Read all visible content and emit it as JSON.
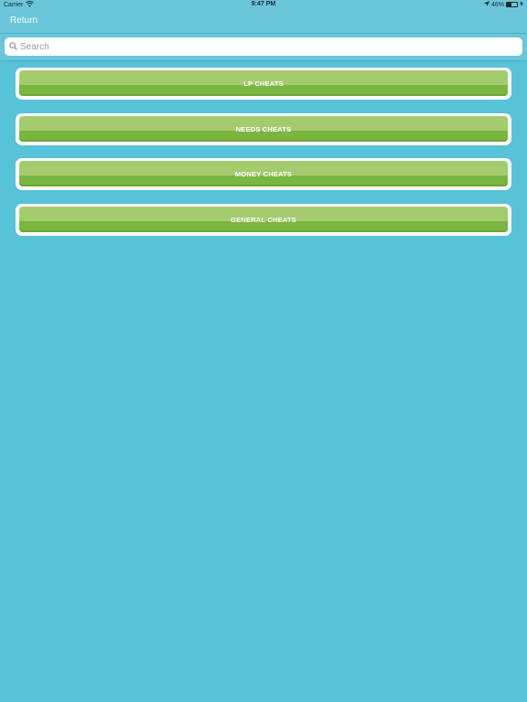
{
  "status_bar": {
    "carrier": "Carrier",
    "time": "9:47 PM",
    "battery_percent": "46%",
    "battery_level": 0.46
  },
  "nav": {
    "return_label": "Return"
  },
  "search": {
    "placeholder": "Search",
    "value": ""
  },
  "cheats": [
    {
      "label": "LP CHEATS"
    },
    {
      "label": "NEEDS CHEATS"
    },
    {
      "label": "MONEY CHEATS"
    },
    {
      "label": "GENERAL CHEATS"
    }
  ],
  "colors": {
    "background": "#58c2d8",
    "bar": "#6ac6d9",
    "button_light": "#a4cc6e",
    "button_dark": "#7bb640"
  }
}
